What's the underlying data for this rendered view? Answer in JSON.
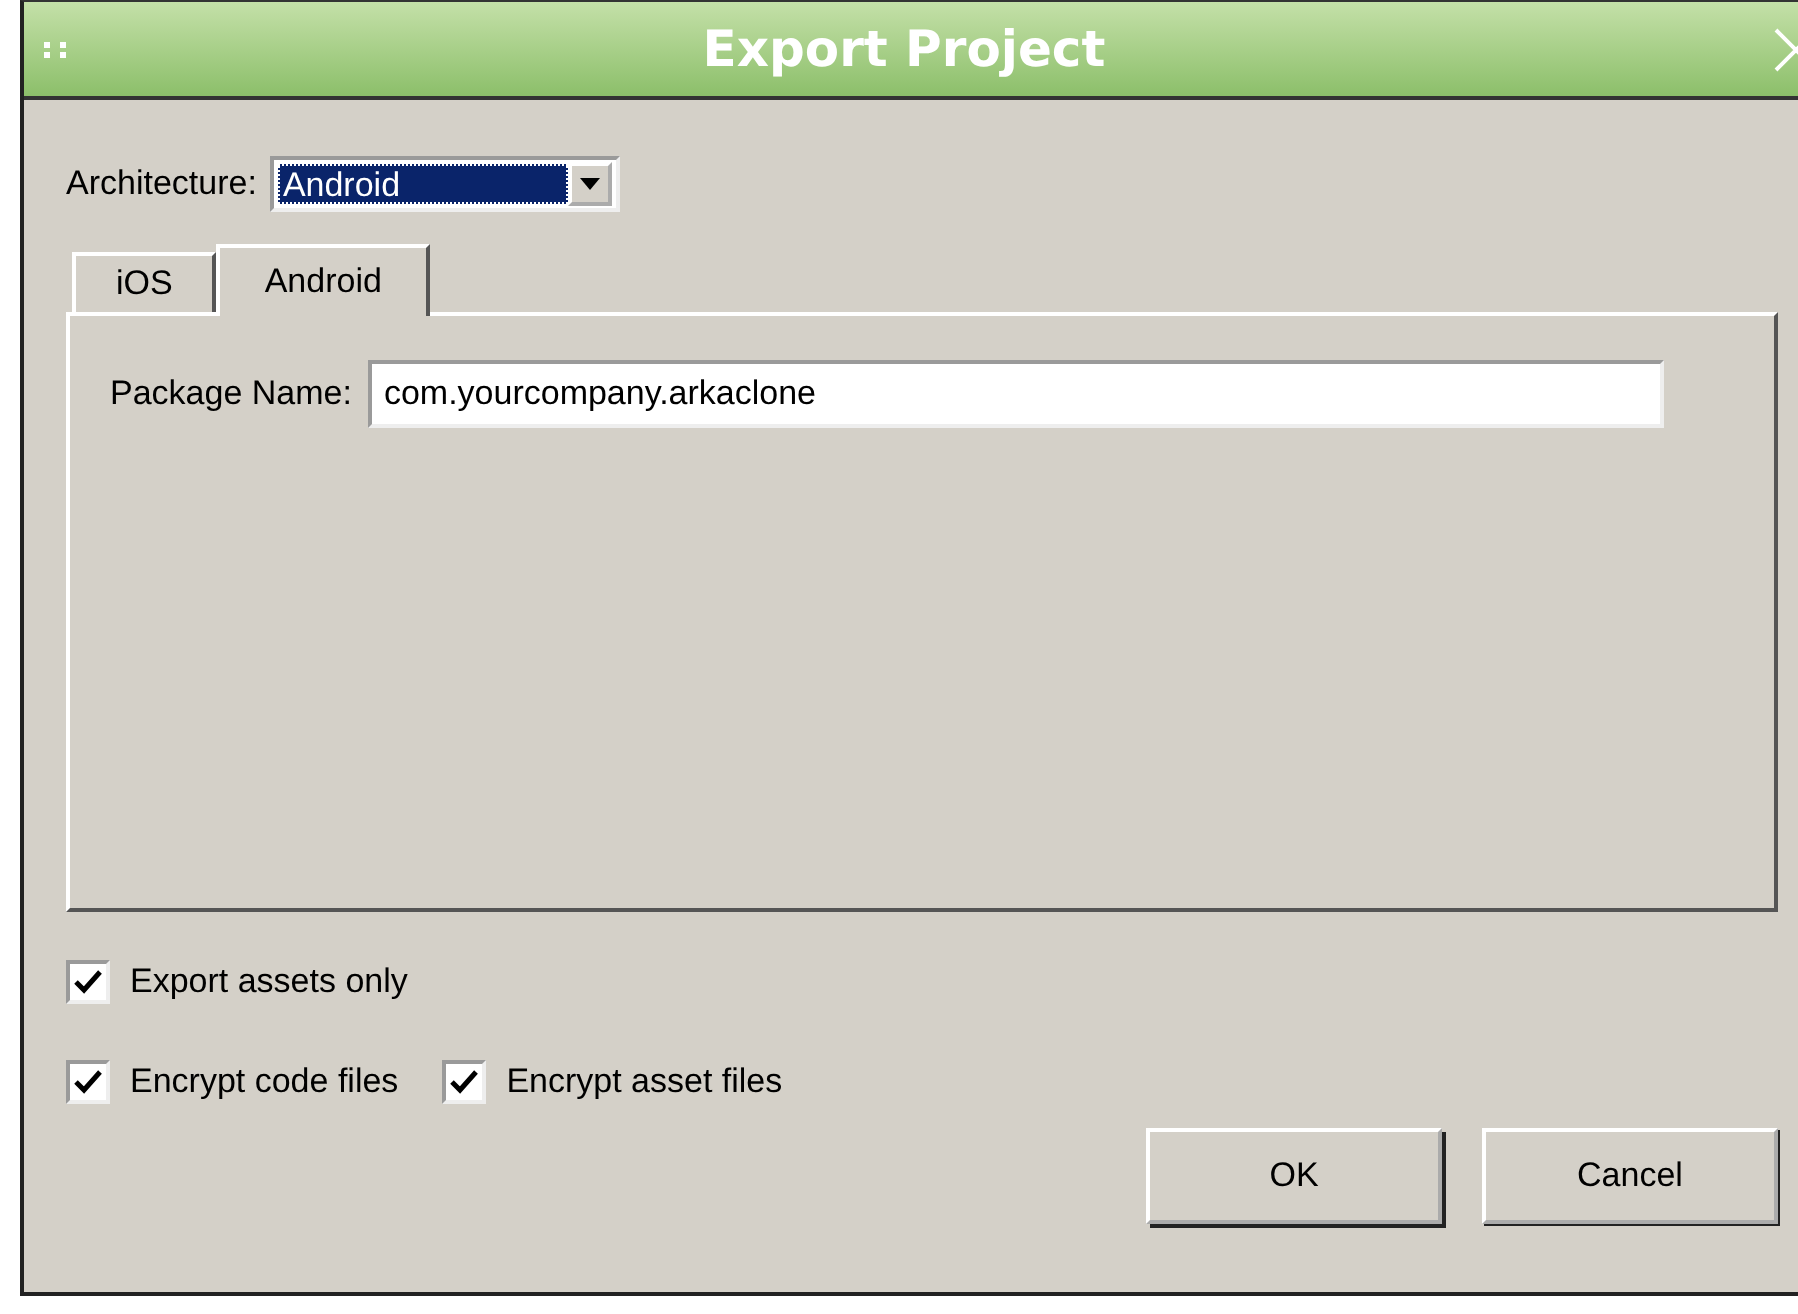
{
  "window": {
    "title": "Export Project"
  },
  "architecture": {
    "label": "Architecture:",
    "value": "Android"
  },
  "tabs": [
    {
      "label": "iOS",
      "selected": false
    },
    {
      "label": "Android",
      "selected": true
    }
  ],
  "package_name": {
    "label": "Package Name:",
    "value": "com.yourcompany.arkaclone"
  },
  "options": [
    {
      "label": "Export assets only",
      "checked": true
    },
    {
      "label": "Encrypt code files",
      "checked": true
    },
    {
      "label": "Encrypt asset files",
      "checked": true
    }
  ],
  "buttons": [
    "OK",
    "Cancel"
  ]
}
